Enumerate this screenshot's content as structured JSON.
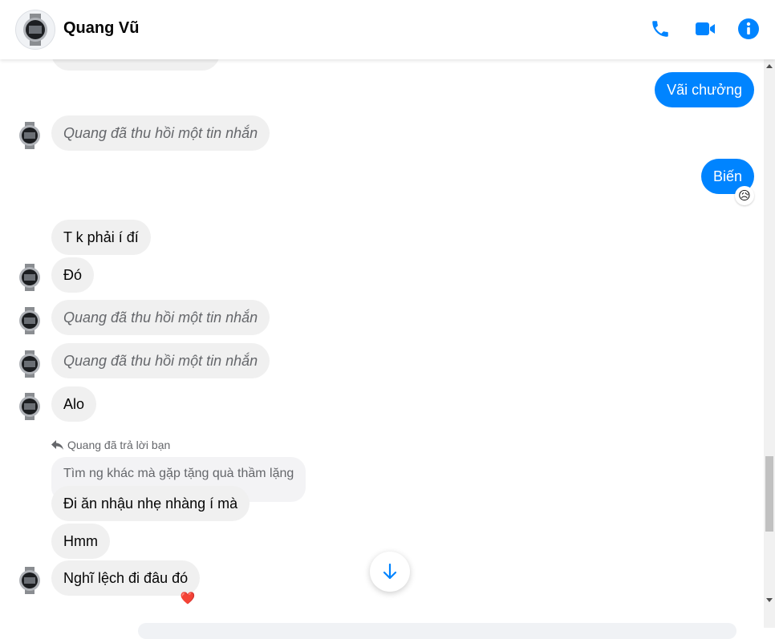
{
  "header": {
    "contact_name": "Quang Vũ",
    "call_icon": "phone-icon",
    "video_icon": "video-camera-icon",
    "info_icon": "info-icon",
    "accent_color": "#0084ff"
  },
  "messages": {
    "out_1": "Vãi chưởng",
    "recalled_1": "Quang đã thu hồi một tin nhắn",
    "out_2": "Biến",
    "out_2_reaction": "😥",
    "in_1": "T k phải í đí",
    "in_2": "Đó",
    "recalled_2": "Quang đã thu hồi một tin nhắn",
    "recalled_3": "Quang đã thu hồi một tin nhắn",
    "in_3": "Alo",
    "reply_label": "Quang đã trả lời bạn",
    "quoted_text": "Tìm ng khác mà gặp tặng quà thầm lặng",
    "in_4": "Đi ăn nhậu nhẹ nhàng í mà",
    "in_5": "Hmm",
    "in_6": "Nghĩ lệch đi đâu đó",
    "in_6_reaction": "❤️"
  },
  "colors": {
    "outgoing_bubble": "#0084ff",
    "incoming_bubble": "#f0f0f0",
    "secondary_text": "#65676b"
  }
}
